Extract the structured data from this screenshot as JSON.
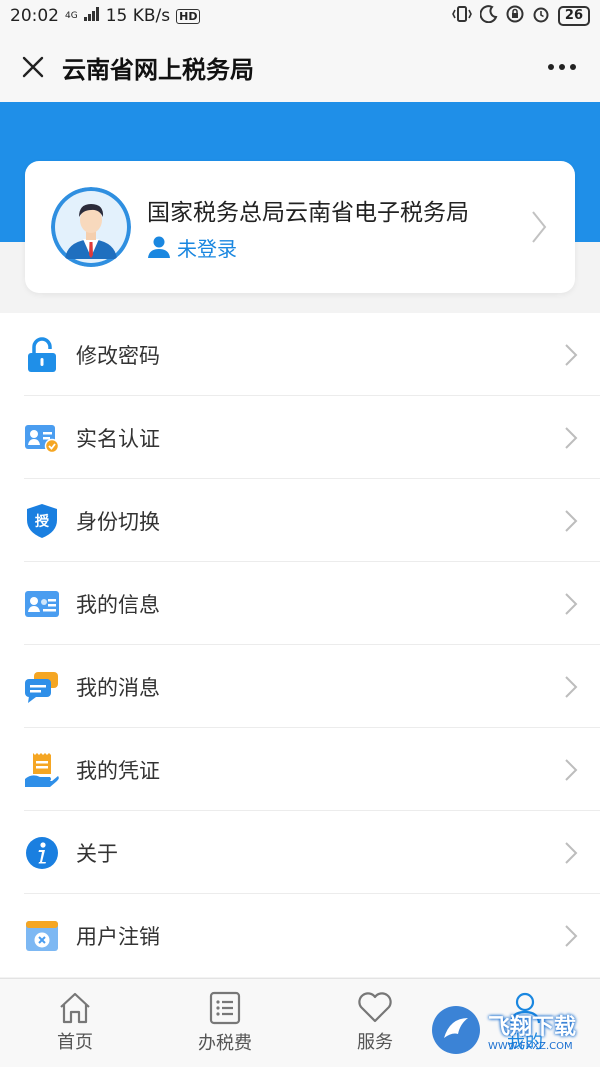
{
  "status_bar": {
    "time": "20:02",
    "network": "4G",
    "speed": "15 KB/s",
    "hd": "HD",
    "battery": "26"
  },
  "titlebar": {
    "title": "云南省网上税务局"
  },
  "profile": {
    "org_name": "国家税务总局云南省电子税务局",
    "login_status": "未登录"
  },
  "menu": {
    "items": [
      {
        "label": "修改密码",
        "icon": "lock-icon"
      },
      {
        "label": "实名认证",
        "icon": "id-verify-icon"
      },
      {
        "label": "身份切换",
        "icon": "shield-authorize-icon"
      },
      {
        "label": "我的信息",
        "icon": "info-card-icon"
      },
      {
        "label": "我的消息",
        "icon": "message-icon"
      },
      {
        "label": "我的凭证",
        "icon": "voucher-icon"
      },
      {
        "label": "关于",
        "icon": "about-icon"
      },
      {
        "label": "用户注销",
        "icon": "deregister-icon"
      }
    ]
  },
  "bottom_nav": {
    "items": [
      {
        "label": "首页",
        "icon": "home-icon"
      },
      {
        "label": "办税费",
        "icon": "list-icon"
      },
      {
        "label": "服务",
        "icon": "heart-icon"
      },
      {
        "label": "我的",
        "icon": "user-icon"
      }
    ]
  },
  "watermark": {
    "text": "飞翔下载",
    "url": "WWW.FXXZ.COM"
  },
  "colors": {
    "brand_blue": "#1f8fe8",
    "link_blue": "#1a87e0"
  }
}
